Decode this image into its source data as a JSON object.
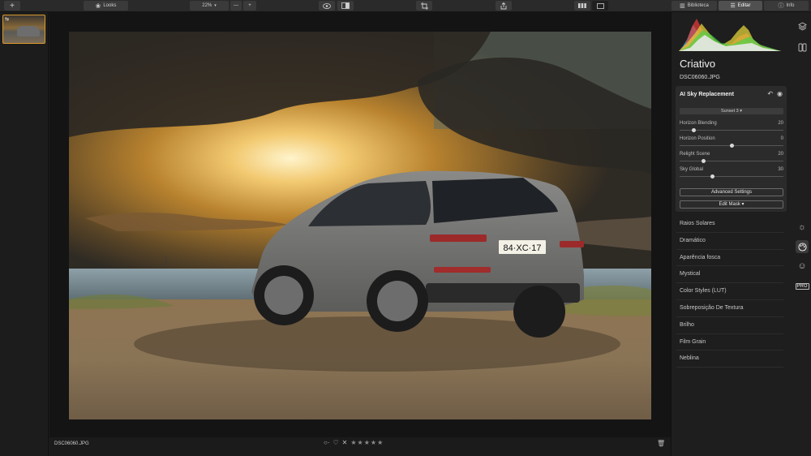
{
  "toolbar": {
    "add_icon": "plus-icon",
    "looks_label": "Looks",
    "zoom_value": "22%",
    "zoom_minus": "—",
    "zoom_plus": "+",
    "tabs": [
      {
        "label": "Biblioteca",
        "icon": "library-icon",
        "active": false
      },
      {
        "label": "Editar",
        "icon": "sliders-icon",
        "active": true
      },
      {
        "label": "Info",
        "icon": "info-icon",
        "active": false
      }
    ]
  },
  "filmstrip": {
    "thumb_badge": "⇆"
  },
  "bottom": {
    "filename": "DSC06060.JPG",
    "stars": "★★★★★",
    "reject": "✕",
    "heart": "♡",
    "circle": "○·"
  },
  "panel": {
    "title": "Criativo",
    "filename": "DSC06060.JPG",
    "sky": {
      "title": "AI Sky Replacement",
      "preset": "Sunset 3 ▾",
      "sliders": [
        {
          "label": "Horizon Blending",
          "value": "20",
          "level": 0.12
        },
        {
          "label": "Horizon Position",
          "value": "0",
          "level": 0.5
        },
        {
          "label": "Relight Scene",
          "value": "20",
          "level": 0.22
        },
        {
          "label": "Sky Global",
          "value": "30",
          "level": 0.31
        }
      ],
      "advanced": "Advanced Settings",
      "edit_mask": "Edit Mask ▾"
    },
    "filters": [
      "Raios Solares",
      "Dramático",
      "Aparência fosca",
      "Mystical",
      "Color Styles (LUT)",
      "Sobreposição De Textura",
      "Brilho",
      "Film Grain",
      "Neblina"
    ],
    "side_icons": [
      "layers-icon",
      "compare-icon",
      "sun-icon",
      "palette-icon",
      "face-icon",
      "pro-icon"
    ],
    "pro_label": "PRO"
  },
  "photo": {
    "plate": "84·XC·17"
  },
  "colors": {
    "accent": "#d99a2b"
  }
}
